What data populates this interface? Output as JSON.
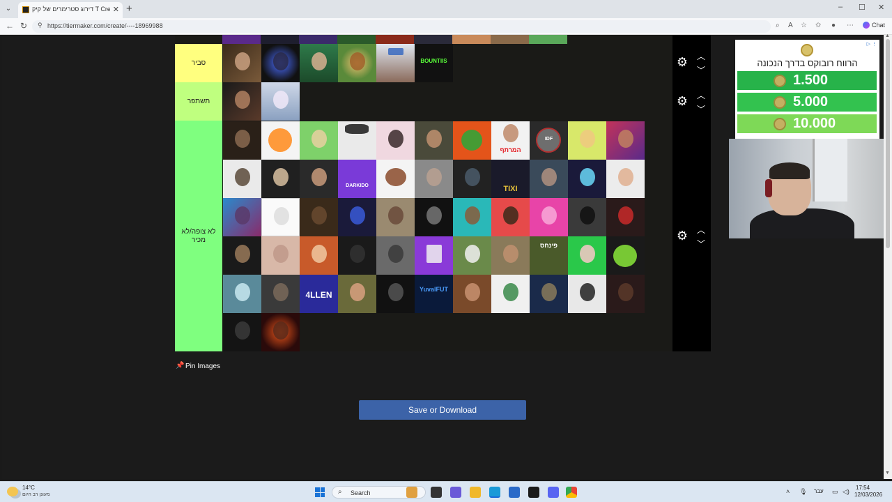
{
  "browser": {
    "tab_title": "דירוג סטרימרים של קיק T Create a",
    "new_tab": "+",
    "url": "https://tiermaker.com/create/----18969988",
    "chat_label": "Chat",
    "window_controls": [
      "–",
      "☐",
      "✕"
    ]
  },
  "tiers": [
    {
      "label": "סביר",
      "color": "#ffff7f"
    },
    {
      "label": "תשתפר",
      "color": "#bfff7f"
    },
    {
      "label": "לא צופה/לא מכיר",
      "color": "#7fff7f"
    }
  ],
  "thumb_text": {
    "bountiis": "BOUNTIIS",
    "allen": "4LLEN",
    "yuval": "YuvalFUT",
    "marter": "המרתף",
    "pinchas": "פינחס",
    "tixi": "TIXI",
    "darkido": "DARKIDO",
    "idf": "IDF"
  },
  "pin_images_label": "Pin Images",
  "save_button_label": "Save or Download",
  "ad": {
    "title": "הרווח רובוקס בדרך הנכונה",
    "amounts": [
      "1.500",
      "5.000",
      "10.000"
    ],
    "pill_colors": [
      "#27b34a",
      "#33c24f",
      "#7ed957"
    ]
  },
  "taskbar": {
    "temperature": "14°C",
    "weather": "מעונן רב היום",
    "search_label": "Search",
    "language": "עבר",
    "time": "17:54",
    "date": "12/03/2026"
  },
  "colors": {
    "save_button": "#3c63a8",
    "control_column": "#000000",
    "table_bg": "#1a1a17"
  }
}
